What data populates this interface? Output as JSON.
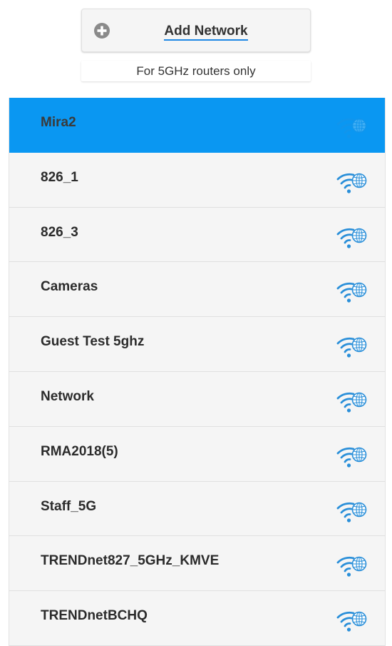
{
  "add_network": {
    "icon": "plus-circle-icon",
    "label": "Add Network"
  },
  "note": "For 5GHz routers only",
  "colors": {
    "selected_row": "#0a97f2",
    "wifi_icon": "#2a8fd9",
    "row_background": "#f5f5f5"
  },
  "networks": [
    {
      "name": "Mira2",
      "selected": true,
      "icon": "wifi-globe-icon"
    },
    {
      "name": "826_1",
      "selected": false,
      "icon": "wifi-globe-icon"
    },
    {
      "name": "826_3",
      "selected": false,
      "icon": "wifi-globe-icon"
    },
    {
      "name": "Cameras",
      "selected": false,
      "icon": "wifi-globe-icon"
    },
    {
      "name": "Guest Test 5ghz",
      "selected": false,
      "icon": "wifi-globe-icon"
    },
    {
      "name": "Network",
      "selected": false,
      "icon": "wifi-globe-icon"
    },
    {
      "name": "RMA2018(5)",
      "selected": false,
      "icon": "wifi-globe-icon"
    },
    {
      "name": "Staff_5G",
      "selected": false,
      "icon": "wifi-globe-icon"
    },
    {
      "name": "TRENDnet827_5GHz_KMVE",
      "selected": false,
      "icon": "wifi-globe-icon"
    },
    {
      "name": "TRENDnetBCHQ",
      "selected": false,
      "icon": "wifi-globe-icon"
    }
  ]
}
